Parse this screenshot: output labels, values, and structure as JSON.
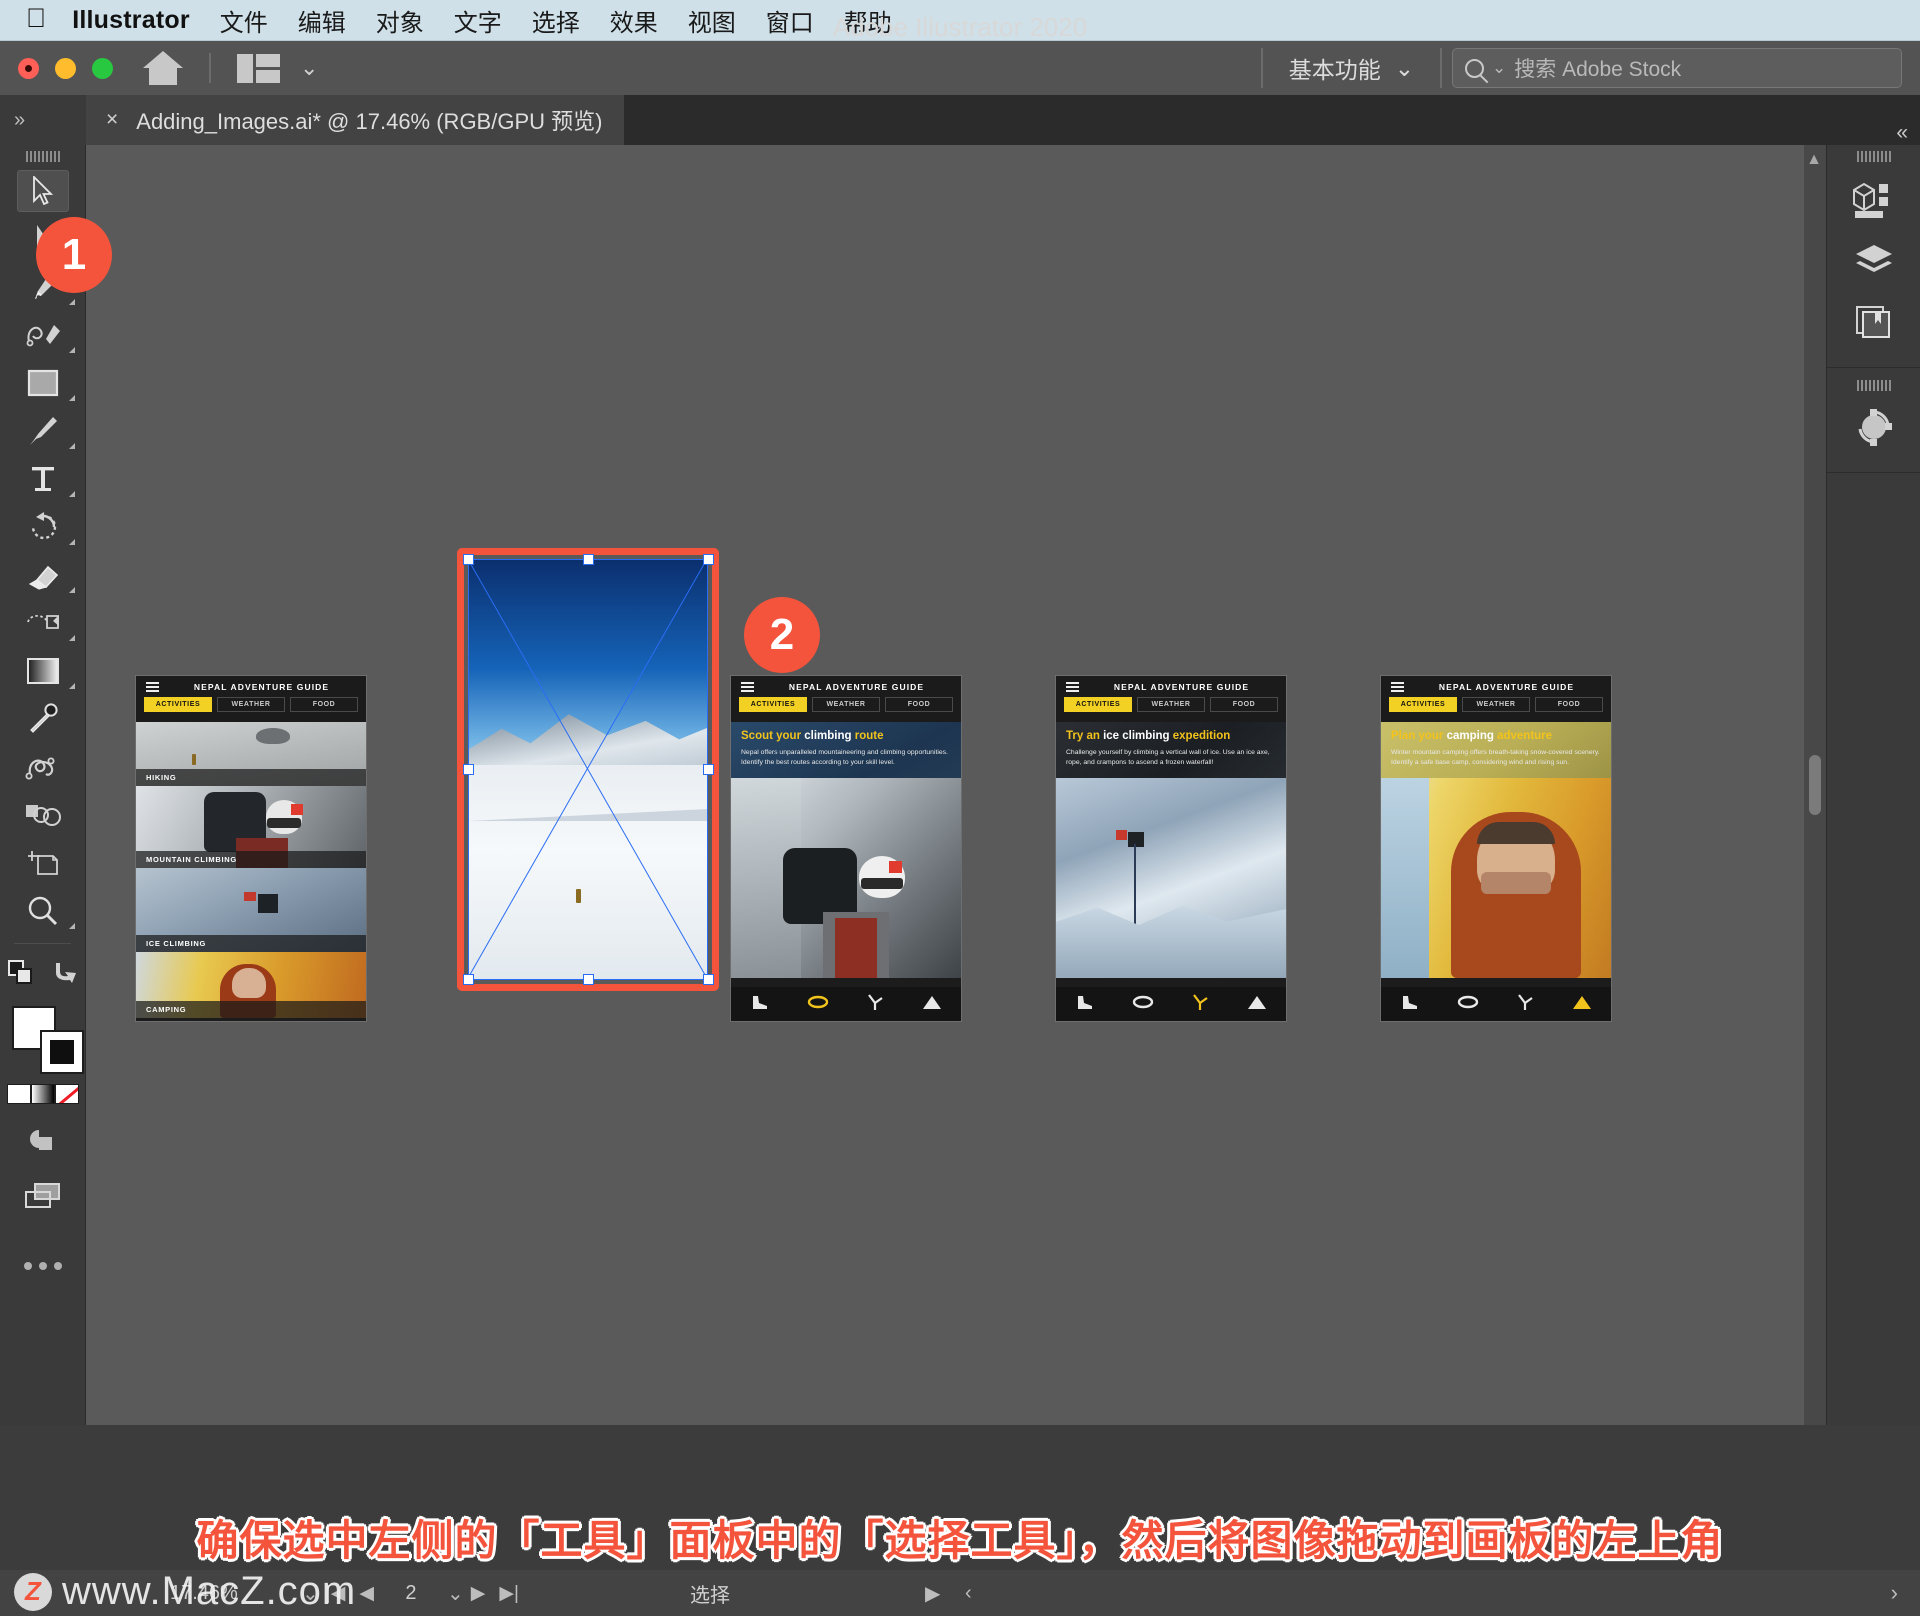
{
  "menubar": {
    "apple_icon": "apple-logo",
    "app": "Illustrator",
    "items": [
      "文件",
      "编辑",
      "对象",
      "文字",
      "选择",
      "效果",
      "视图",
      "窗口",
      "帮助"
    ]
  },
  "titlebar": {
    "title": "Adobe Illustrator 2020",
    "home_icon": "home-icon",
    "layout_icon": "layout-switcher-icon",
    "workspace": "基本功能",
    "workspace_chevron": "chevron-down-icon",
    "search_icon": "search-icon",
    "search_placeholder": "搜索 Adobe Stock",
    "search_value": ""
  },
  "tabbar": {
    "expand_icon": "»",
    "close_icon": "×",
    "doc_title": "Adding_Images.ai* @ 17.46% (RGB/GPU 预览)",
    "collapse_icon": "«"
  },
  "toolbar": {
    "tools": [
      {
        "name": "selection-tool",
        "label": "选择工具",
        "active": true,
        "corner": false
      },
      {
        "name": "direct-selection-tool",
        "label": "直接选择工具",
        "active": false,
        "corner": true
      },
      {
        "name": "pen-tool",
        "label": "钢笔工具",
        "active": false,
        "corner": true
      },
      {
        "name": "curvature-tool",
        "label": "曲率工具",
        "active": false,
        "corner": true
      },
      {
        "name": "rectangle-tool",
        "label": "矩形工具",
        "active": false,
        "corner": true
      },
      {
        "name": "paintbrush-tool",
        "label": "画笔工具",
        "active": false,
        "corner": true
      },
      {
        "name": "type-tool",
        "label": "文字工具",
        "active": false,
        "corner": true
      },
      {
        "name": "rotate-tool",
        "label": "旋转工具",
        "active": false,
        "corner": true
      },
      {
        "name": "eraser-tool",
        "label": "橡皮擦工具",
        "active": false,
        "corner": true
      },
      {
        "name": "scale-tool",
        "label": "比例缩放工具",
        "active": false,
        "corner": true
      },
      {
        "name": "gradient-tool",
        "label": "渐变工具",
        "active": false,
        "corner": true
      },
      {
        "name": "eyedropper-tool",
        "label": "吸管工具",
        "active": false,
        "corner": false
      },
      {
        "name": "blend-tool",
        "label": "混合工具",
        "active": false,
        "corner": false
      },
      {
        "name": "shape-builder-tool",
        "label": "形状生成器工具",
        "active": false,
        "corner": false
      },
      {
        "name": "artboard-tool",
        "label": "画板工具",
        "active": false,
        "corner": false
      },
      {
        "name": "zoom-tool",
        "label": "缩放工具",
        "active": false,
        "corner": true
      }
    ],
    "more_tools_icon": "ellipsis-icon",
    "fill_color": "#ffffff",
    "stroke_color": "#000000"
  },
  "rightdock": {
    "icons": [
      {
        "name": "properties-panel-icon",
        "label": "属性"
      },
      {
        "name": "layers-panel-icon",
        "label": "图层"
      },
      {
        "name": "libraries-panel-icon",
        "label": "库"
      },
      {
        "name": "asset-export-panel-icon",
        "label": "资源导出"
      }
    ]
  },
  "canvas": {
    "accent_color": "#f4543c",
    "selection_color": "#2a6df5",
    "badges": [
      {
        "name": "step-badge-1",
        "value": "1"
      },
      {
        "name": "step-badge-2",
        "value": "2"
      }
    ],
    "artboards": [
      {
        "id": "artboard-1",
        "nav_title": "NEPAL ADVENTURE GUIDE",
        "tabs": [
          "ACTIVITIES",
          "WEATHER",
          "FOOD"
        ],
        "active_tab": "ACTIVITIES",
        "sections": [
          "HIKING",
          "MOUNTAIN CLIMBING",
          "ICE CLIMBING",
          "CAMPING"
        ]
      },
      {
        "id": "artboard-2-selected",
        "nav_title": "",
        "tabs": [],
        "active_tab": "",
        "sections": []
      },
      {
        "id": "artboard-3",
        "nav_title": "NEPAL ADVENTURE GUIDE",
        "tabs": [
          "ACTIVITIES",
          "WEATHER",
          "FOOD"
        ],
        "active_tab": "ACTIVITIES",
        "heading_parts": [
          {
            "text": "Scout your ",
            "color": "yellow"
          },
          {
            "text": "climbing ",
            "color": "white"
          },
          {
            "text": "route",
            "color": "yellow"
          }
        ],
        "body": "Nepal offers unparalleled mountaineering and climbing opportunities. Identify the best routes according to your skill level.",
        "footer_icons": [
          "boot-icon",
          "carabiner-icon",
          "ice-axe-icon",
          "tent-icon"
        ]
      },
      {
        "id": "artboard-4",
        "nav_title": "NEPAL ADVENTURE GUIDE",
        "tabs": [
          "ACTIVITIES",
          "WEATHER",
          "FOOD"
        ],
        "active_tab": "ACTIVITIES",
        "heading_parts": [
          {
            "text": "Try an ",
            "color": "yellow"
          },
          {
            "text": "ice climbing ",
            "color": "white"
          },
          {
            "text": "expedition",
            "color": "yellow"
          }
        ],
        "body": "Challenge yourself by climbing a vertical wall of ice. Use an ice axe, rope, and crampons to ascend a frozen waterfall!",
        "footer_icons": [
          "boot-icon",
          "carabiner-icon",
          "ice-axe-icon",
          "tent-icon"
        ]
      },
      {
        "id": "artboard-5",
        "nav_title": "NEPAL ADVENTURE GUIDE",
        "tabs": [
          "ACTIVITIES",
          "WEATHER",
          "FOOD"
        ],
        "active_tab": "ACTIVITIES",
        "heading_parts": [
          {
            "text": "Plan your ",
            "color": "yellow"
          },
          {
            "text": "camping ",
            "color": "white"
          },
          {
            "text": "adventure",
            "color": "yellow"
          }
        ],
        "body": "Winter mountain camping offers breath-taking snow-covered scenery. Identify a safe base camp, considering wind and rising sun.",
        "footer_icons": [
          "boot-icon",
          "carabiner-icon",
          "ice-axe-icon",
          "tent-icon"
        ]
      }
    ]
  },
  "caption": "确保选中左侧的「工具」面板中的「选择工具」，然后将图像拖动到画板的左上角",
  "statusbar": {
    "zoom": "17.46%",
    "zoom_chevron": "chevron-down-icon",
    "prev_artboard_icon": "◀",
    "first_artboard_icon": "|◀",
    "artboard_number": "2",
    "artboard_chevron": "chevron-down-icon",
    "next_artboard_icon": "▶",
    "last_artboard_icon": "▶|",
    "status_text": "选择",
    "play_icon": "▶",
    "left_icon": "‹",
    "right_icon": "›"
  },
  "watermark": {
    "badge": "Z",
    "text": "www.MacZ.com"
  }
}
